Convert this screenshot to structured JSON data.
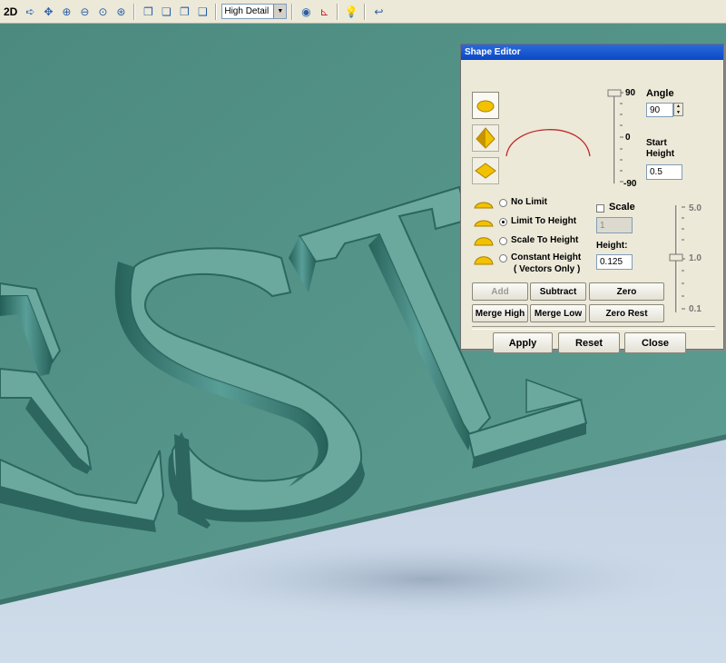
{
  "toolbar": {
    "mode_label": "2D",
    "detail_select": "High Detail",
    "icons": [
      "pointer-icon",
      "pan-icon",
      "zoom-in-icon",
      "zoom-out-icon",
      "zoom-window-icon",
      "zoom-fit-icon",
      "cube-iso-icon",
      "cube-front-icon",
      "cube-side-icon",
      "cube-top-icon",
      "shaded-view-icon",
      "axes-icon",
      "light-bulb-icon",
      "render-icon"
    ]
  },
  "scene": {
    "text": "EST",
    "colors": {
      "relief_top": "#5a9a8e",
      "relief_edge": "#2f6e66",
      "floor": "#c3d3e3"
    }
  },
  "shape_editor": {
    "title": "Shape Editor",
    "angle_label": "Angle",
    "angle_value": "90",
    "start_height_label_1": "Start",
    "start_height_label_2": "Height",
    "start_height_value": "0.5",
    "slider1": {
      "top": "90",
      "mid": "0",
      "bottom": "-90",
      "value": 90
    },
    "limit_options": [
      {
        "label": "No Limit",
        "selected": false
      },
      {
        "label": "Limit To Height",
        "selected": true
      },
      {
        "label": "Scale To Height",
        "selected": false
      },
      {
        "label": "Constant Height",
        "sub": "( Vectors Only )",
        "selected": false
      }
    ],
    "scale_label": "Scale",
    "scale_checked": false,
    "scale_value": "1",
    "height_label": "Height:",
    "height_value": "0.125",
    "slider2": {
      "top": "5.0",
      "mid": "1.0",
      "bottom": "0.1"
    },
    "buttons": {
      "add": "Add",
      "subtract": "Subtract",
      "zero": "Zero",
      "merge_high": "Merge High",
      "merge_low": "Merge Low",
      "zero_rest": "Zero Rest",
      "apply": "Apply",
      "reset": "Reset",
      "close": "Close"
    }
  }
}
